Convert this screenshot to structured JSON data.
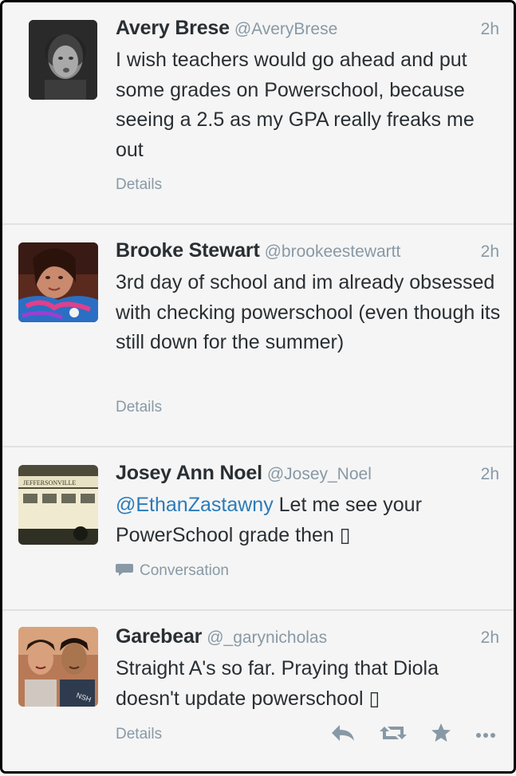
{
  "tweets": [
    {
      "name": "Avery Brese",
      "handle": "@AveryBrese",
      "time": "2h",
      "text": "I wish teachers would go ahead and put some grades on Powerschool, because seeing a 2.5 as my GPA really freaks me out",
      "footer": "Details"
    },
    {
      "name": "Brooke Stewart",
      "handle": "@brookeestewartt",
      "time": "2h",
      "text": "3rd day of school and im already obsessed with checking powerschool (even though its still down for the summer)",
      "footer": "Details"
    },
    {
      "name": "Josey Ann Noel",
      "handle": "@Josey_Noel",
      "time": "2h",
      "mention": "@EthanZastawny",
      "text": " Let me see your PowerSchool grade then ▯",
      "footer": "Conversation",
      "bus_sign": "JEFFERSONVILLE"
    },
    {
      "name": "Garebear",
      "handle": "@_garynicholas",
      "time": "2h",
      "text": "Straight A's so far. Praying that Diola doesn't update powerschool ▯",
      "footer": "Details"
    }
  ],
  "actions": {
    "reply_icon": "reply-icon",
    "retweet_icon": "retweet-icon",
    "favorite_icon": "star-icon",
    "more_icon": "more-icon"
  },
  "colors": {
    "name": "#292f33",
    "meta": "#8899a6",
    "mention": "#2b7bb9",
    "divider": "#e1e1e1"
  }
}
